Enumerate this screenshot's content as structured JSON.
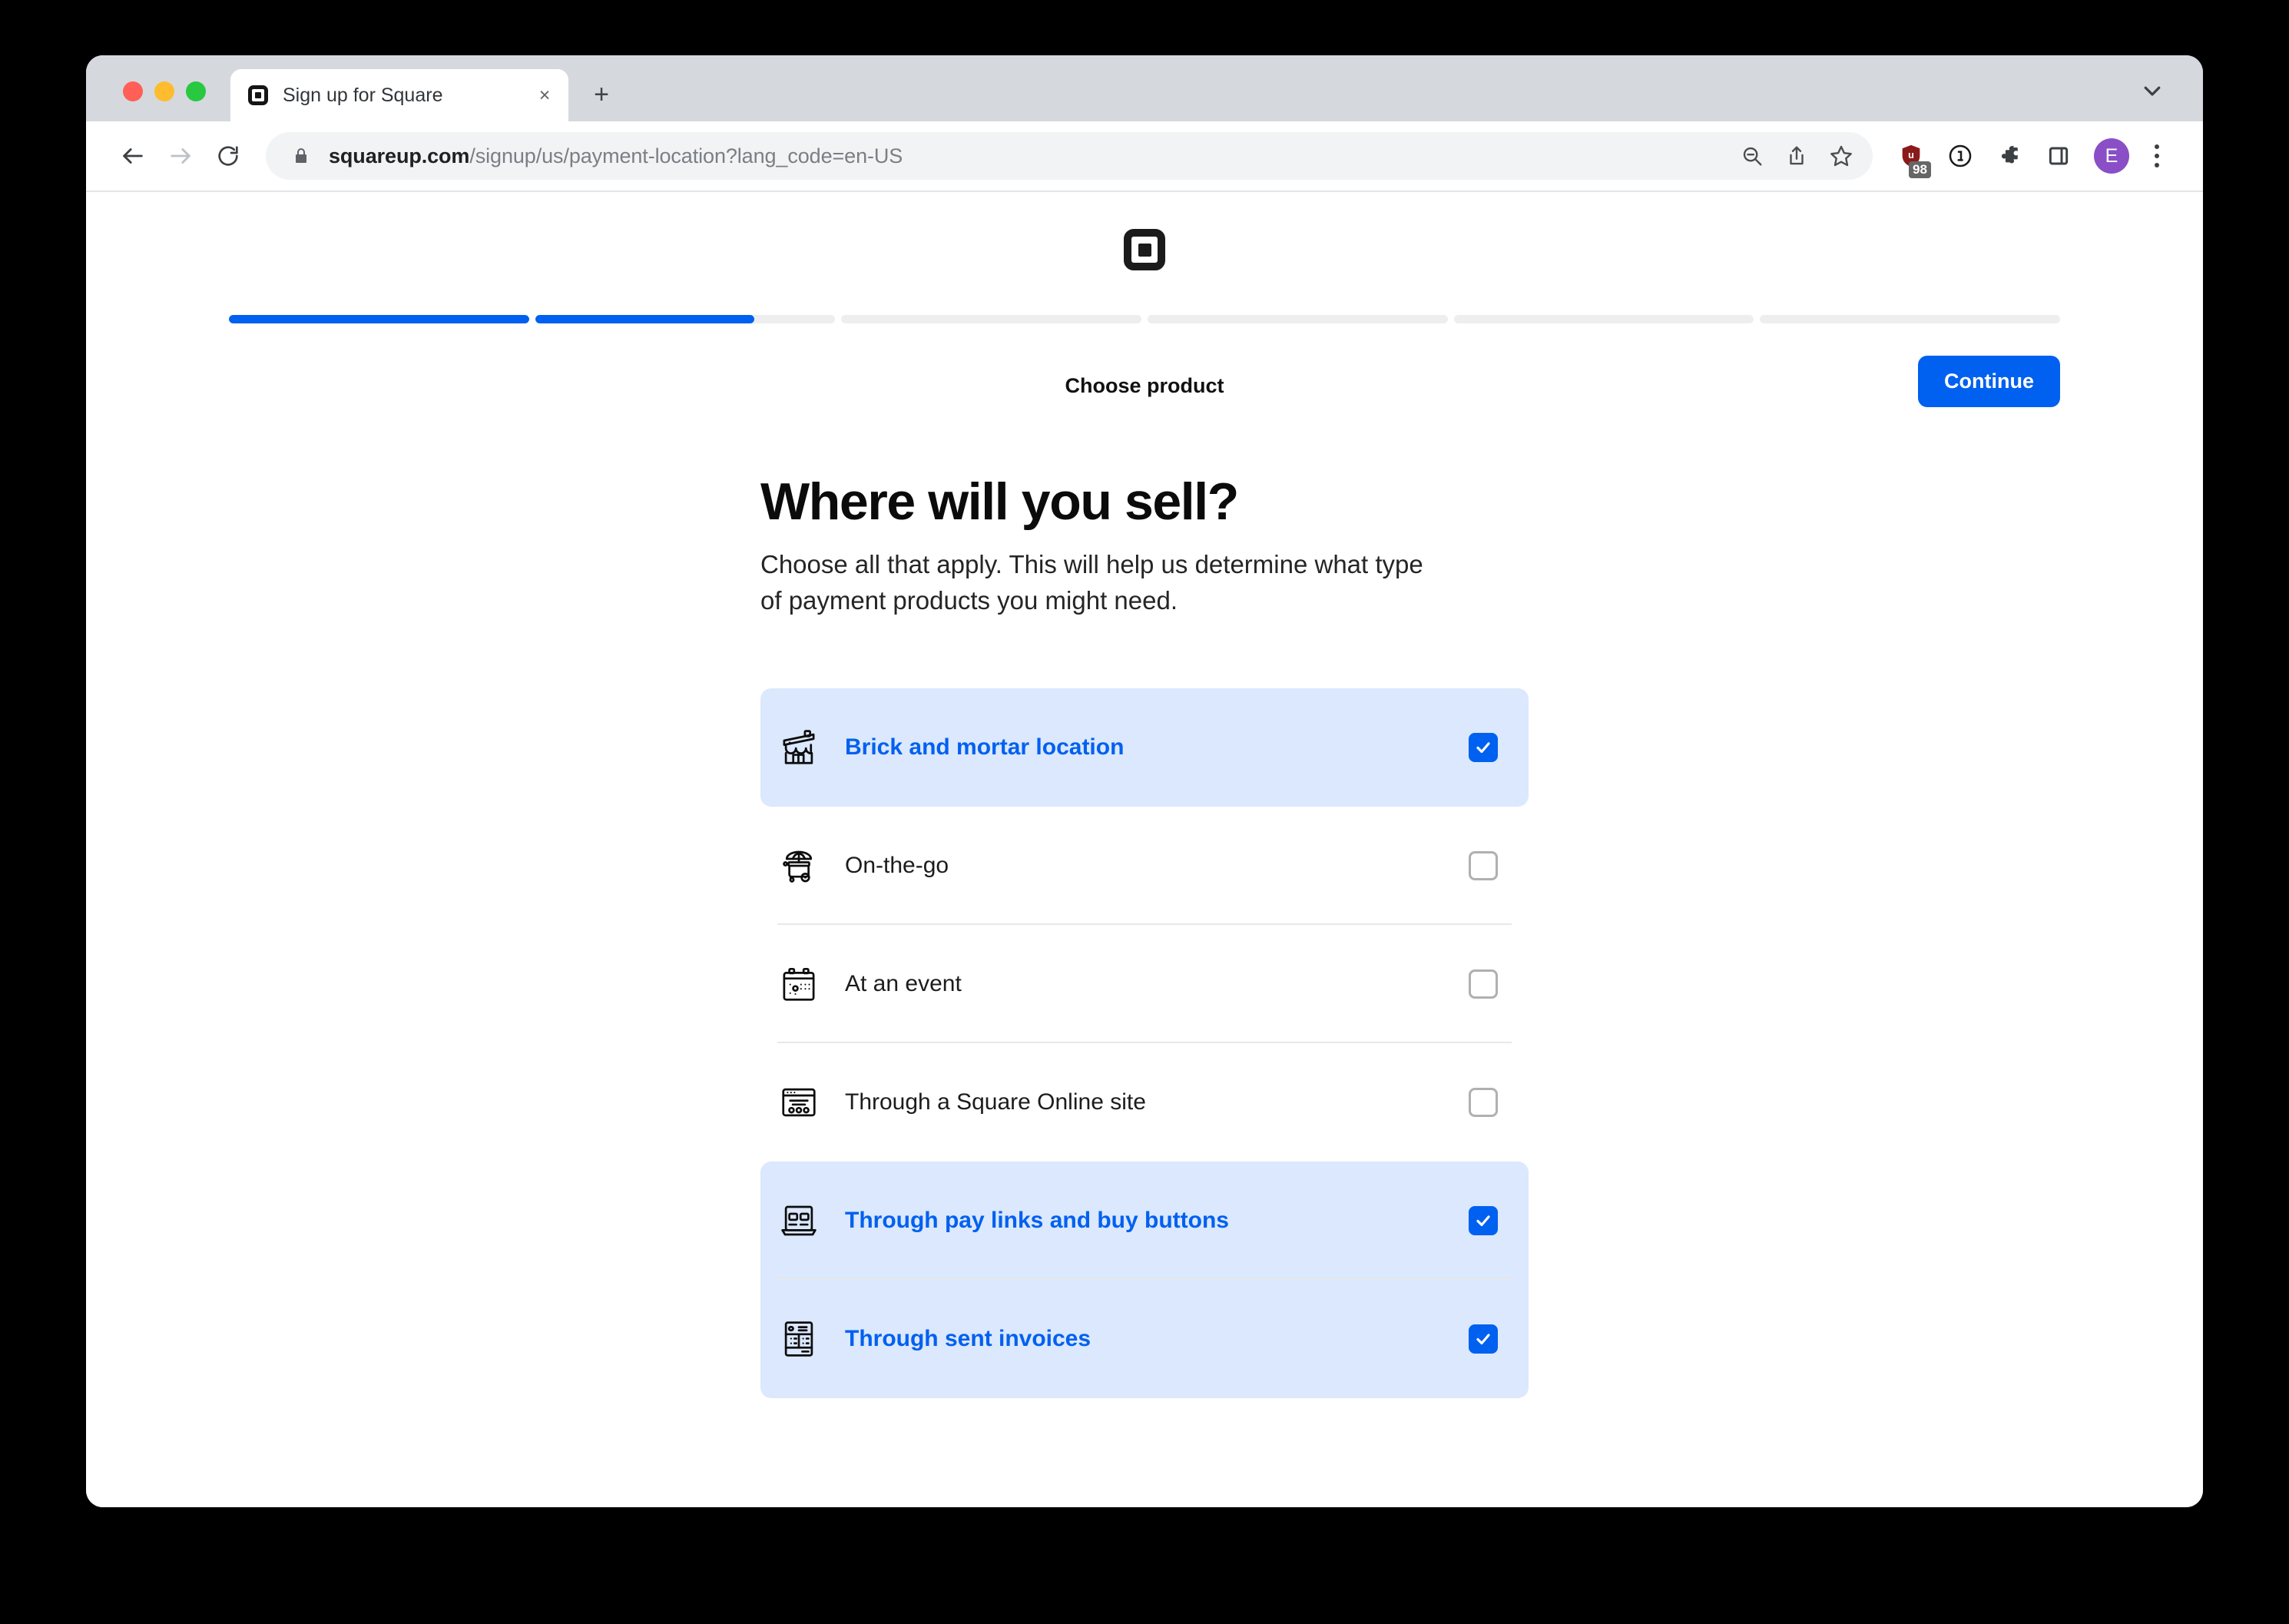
{
  "browser": {
    "tab": {
      "title": "Sign up for Square",
      "favicon": "square-logo-icon",
      "close_label": "×"
    },
    "new_tab_label": "+",
    "toolbar": {
      "back_icon": "arrow-left-icon",
      "forward_icon": "arrow-right-icon",
      "reload_icon": "reload-icon",
      "lock_icon": "lock-icon",
      "url_host": "squareup.com",
      "url_path": "/signup/us/payment-location?lang_code=en-US",
      "zoom_out_icon": "zoom-out-icon",
      "share_icon": "share-icon",
      "bookmark_icon": "star-icon",
      "ublock_icon": "ublock-shield-icon",
      "ublock_badge": "98",
      "onepassword_icon": "1password-icon",
      "extensions_icon": "puzzle-piece-icon",
      "side_panel_icon": "side-panel-icon",
      "avatar_initial": "E",
      "menu_icon": "three-dot-menu-icon"
    },
    "tab_search_icon": "chevron-down-icon"
  },
  "page": {
    "brand_logo": "square-logo-icon",
    "progress": {
      "segments": [
        100,
        73,
        0,
        0,
        0,
        0
      ],
      "fill_color": "#0060f0",
      "track_color": "#eeeeee"
    },
    "step_label": "Choose product",
    "continue_label": "Continue",
    "title": "Where will you sell?",
    "subtitle": "Choose all that apply. This will help us determine what type of payment products you might need.",
    "options": [
      {
        "label": "Brick and mortar location",
        "icon": "storefront-icon",
        "checked": true
      },
      {
        "label": "On-the-go",
        "icon": "food-cart-icon",
        "checked": false
      },
      {
        "label": "At an event",
        "icon": "calendar-icon",
        "checked": false
      },
      {
        "label": "Through a Square Online site",
        "icon": "website-window-icon",
        "checked": false
      },
      {
        "label": "Through pay links and buy buttons",
        "icon": "laptop-icon",
        "checked": true
      },
      {
        "label": "Through sent invoices",
        "icon": "invoice-icon",
        "checked": true
      }
    ],
    "accent_color": "#0060f0",
    "selected_row_bg": "#dbe8fd"
  }
}
